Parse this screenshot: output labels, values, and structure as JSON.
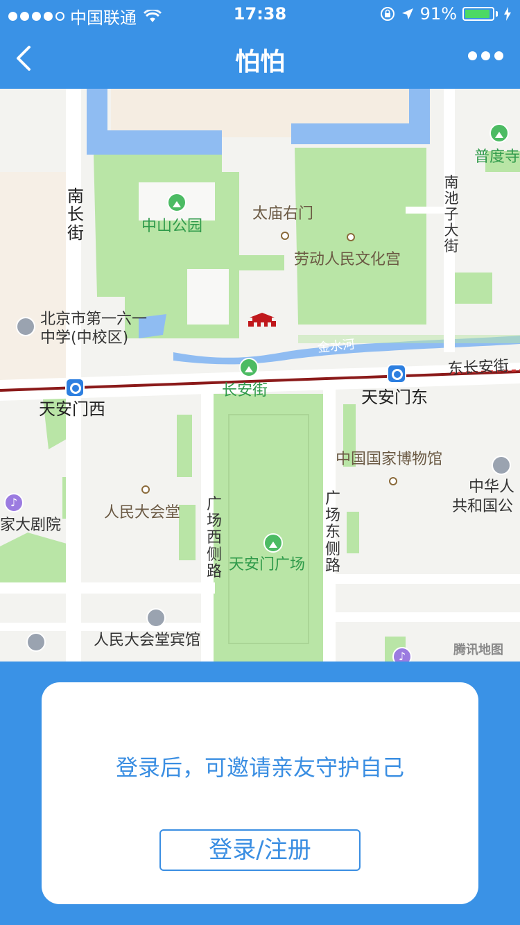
{
  "status_bar": {
    "carrier": "中国联通",
    "time": "17:38",
    "battery_percent": "91%",
    "battery_level": 0.91
  },
  "nav": {
    "title": "怕怕"
  },
  "map": {
    "watermark": "腾讯地图",
    "labels": {
      "nanchangjie": "南长街",
      "zhongshan_park": "中山公园",
      "taimiao_gate": "太庙右门",
      "laodong_palace": "劳动人民文化宫",
      "pudu_temple": "普度寺",
      "nanchizi": "南池子大街",
      "school": "北京市第一六一中学(中校区)",
      "school_line1": "北京市第一六一",
      "school_line2": "中学(中校区)",
      "jinshuihe": "金水河",
      "changanjie": "长安街",
      "east_changan": "东长安街",
      "tiananmen_west": "天安门西",
      "tiananmen_east": "天安门东",
      "national_museum": "中国国家博物馆",
      "prc_line1": "中华人",
      "prc_line2": "共和国公",
      "theatre": "家大剧院",
      "great_hall": "人民大会堂",
      "square_west": "广场西侧路",
      "square_east": "广场东侧路",
      "tiananmen_square": "天安门广场",
      "great_hall_hotel": "人民大会堂宾馆"
    }
  },
  "card": {
    "message": "登录后，可邀请亲友守护自己",
    "button_label": "登录/注册"
  },
  "colors": {
    "brand_blue": "#3a92e6",
    "park_green": "#b9e5a6",
    "water_blue": "#8fbcf2",
    "road_red": "#8b1a1a"
  }
}
